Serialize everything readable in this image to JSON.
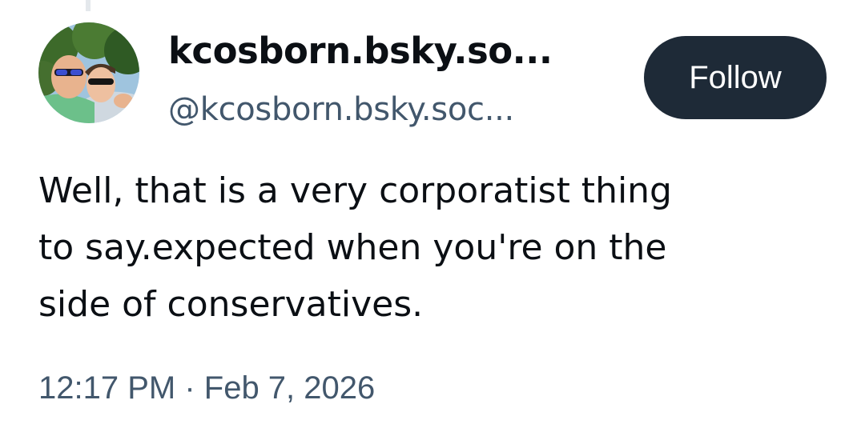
{
  "author": {
    "display_name": "kcosborn.bsky.so...",
    "handle": "@kcosborn.bsky.soc...",
    "avatar_icon": "profile-photo"
  },
  "follow_button": {
    "label": "Follow",
    "background_color": "#1e2a37",
    "text_color": "#ffffff"
  },
  "post": {
    "lines": [
      "Well, that is a very corporatist thing",
      "to say.expected when you're on the",
      "side of conservatives."
    ]
  },
  "meta": {
    "timestamp": "12:17 PM · Feb 7, 2026"
  },
  "colors": {
    "text_primary": "#0b0f14",
    "text_secondary": "#42576c",
    "thread_line": "#e4e8ec"
  }
}
